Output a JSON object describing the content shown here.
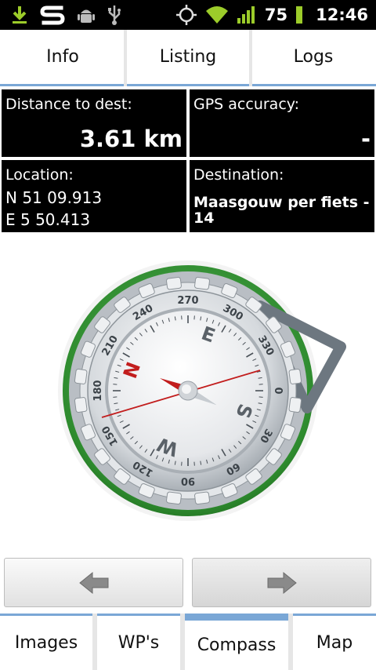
{
  "status_bar": {
    "battery": "75",
    "time": "12:46",
    "icons_left": [
      "download-icon",
      "app-icon",
      "android-debug-icon",
      "usb-icon"
    ],
    "icons_right": [
      "gps-icon",
      "wifi-icon",
      "signal-icon",
      "battery-icon"
    ]
  },
  "top_tabs": [
    {
      "label": "Info"
    },
    {
      "label": "Listing"
    },
    {
      "label": "Logs"
    }
  ],
  "info": {
    "distance": {
      "label": "Distance to dest:",
      "value": "3.61 km"
    },
    "accuracy": {
      "label": "GPS accuracy:",
      "value": "-"
    },
    "location": {
      "label": "Location:",
      "lat": "N 51 09.913",
      "lon": "E 5 50.413"
    },
    "destination": {
      "label": "Destination:",
      "value": "Maasgouw per fiets - 14"
    }
  },
  "compass": {
    "outer_ticks": [
      "270",
      "300",
      "330",
      "0",
      "30",
      "60",
      "90",
      "120",
      "150",
      "180",
      "210",
      "240"
    ],
    "letters": [
      "N",
      "E",
      "S",
      "W"
    ],
    "accent": "#c21d1d",
    "ring_green": "#2e8b2e"
  },
  "buttons": {
    "prev_icon": "arrow-left-icon",
    "next_icon": "arrow-right-icon"
  },
  "bottom_tabs": [
    {
      "label": "Images"
    },
    {
      "label": "WP's"
    },
    {
      "label": "Compass",
      "active": true
    },
    {
      "label": "Map"
    }
  ]
}
